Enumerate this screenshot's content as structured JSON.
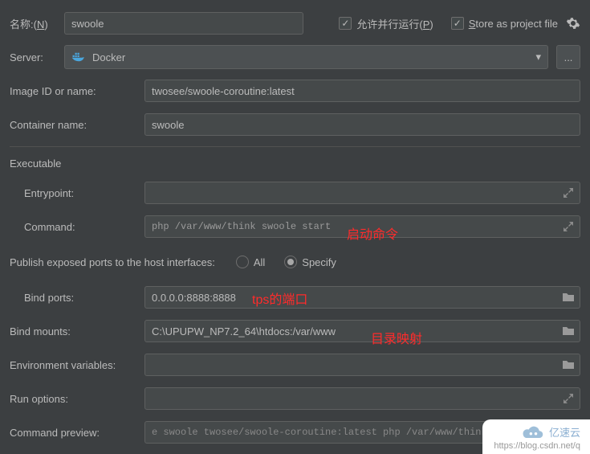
{
  "top": {
    "name_label_pre": "名称:(",
    "name_mnemonic": "N",
    "name_label_post": ")",
    "name_value": "swoole",
    "allow_parallel_pre": "允许并行运行(",
    "allow_parallel_mn": "P",
    "allow_parallel_post": ")",
    "store_pre": "S",
    "store_rest": "tore as project file"
  },
  "server": {
    "label": "Server:",
    "value": "Docker",
    "ellipsis": "..."
  },
  "fields": {
    "image_label": "Image ID or name:",
    "image_value": "twosee/swoole-coroutine:latest",
    "container_label": "Container name:",
    "container_value": "swoole",
    "executable_label": "Executable",
    "entrypoint_label": "Entrypoint:",
    "entrypoint_value": "",
    "command_label": "Command:",
    "command_value": "php /var/www/think swoole start",
    "publish_label": "Publish exposed ports to the host interfaces:",
    "radio_all": "All",
    "radio_specify": "Specify",
    "bind_ports_label": "Bind ports:",
    "bind_ports_value": "0.0.0.0:8888:8888",
    "bind_mounts_label": "Bind mounts:",
    "bind_mounts_value": "C:\\UPUPW_NP7.2_64\\htdocs:/var/www",
    "env_label": "Environment variables:",
    "env_value": "",
    "run_opts_label": "Run options:",
    "run_opts_value": "",
    "cmd_preview_label": "Command preview:",
    "cmd_preview_value": "e swoole twosee/swoole-coroutine:latest php /var/www/think swoole"
  },
  "annotations": {
    "a1": "启动命令",
    "a2": "tps的端口",
    "a3": "目录映射"
  },
  "watermark": {
    "brand": "亿速云",
    "url": "https://blog.csdn.net/q"
  }
}
